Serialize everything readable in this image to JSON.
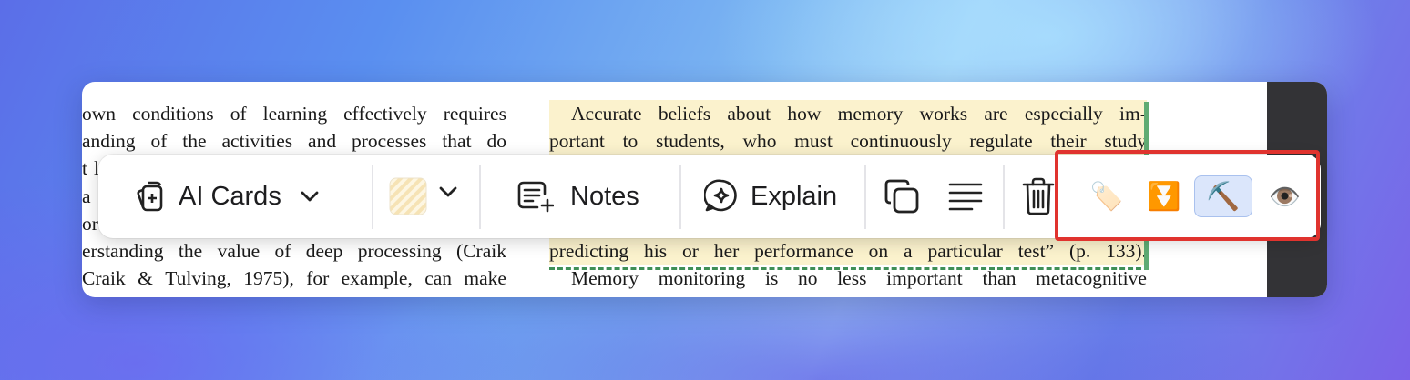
{
  "document": {
    "left_column": [
      [
        "own",
        "conditions",
        "of",
        "learning",
        "effectively",
        "requires"
      ],
      [
        "anding",
        "of",
        "the",
        "activities",
        "and",
        "processes",
        "that",
        "do"
      ],
      [
        "t",
        "l"
      ],
      [
        "a"
      ],
      [
        "or"
      ],
      [
        "erstanding",
        "the",
        "value",
        "of",
        "deep",
        "processing",
        "(Craik"
      ],
      [
        "Craik",
        "&",
        "Tulving,",
        "1975),",
        "for",
        "example,",
        "can",
        "make"
      ]
    ],
    "right_column": [
      [
        "Accurate",
        "beliefs",
        "about",
        "how",
        "memory",
        "works",
        "are",
        "especially",
        "im-"
      ],
      [
        "portant",
        "to",
        "students,",
        "who",
        "must",
        "continuously",
        "regulate",
        "their",
        "study"
      ],
      [],
      [],
      [],
      [
        "predicting",
        "his",
        "or",
        "her",
        "performance",
        "on",
        "a",
        "particular",
        "test”",
        "(p.",
        "133)."
      ],
      [
        "Memory",
        "monitoring",
        "is",
        "no",
        "less",
        "important",
        "than",
        "metacognitive"
      ]
    ]
  },
  "toolbar": {
    "ai_cards_label": "AI Cards",
    "notes_label": "Notes",
    "explain_label": "Explain",
    "highlight_color": "#fbeecb",
    "emoji_tag": "🏷️",
    "emoji_filter": "⏬",
    "emoji_mine": "⛏️",
    "emoji_eye": "👁️"
  },
  "colors": {
    "highlight": "#fbf2cd",
    "annotation_bar": "#5fab73",
    "callout": "#e0332e",
    "active_button": "#dbe6fb"
  }
}
